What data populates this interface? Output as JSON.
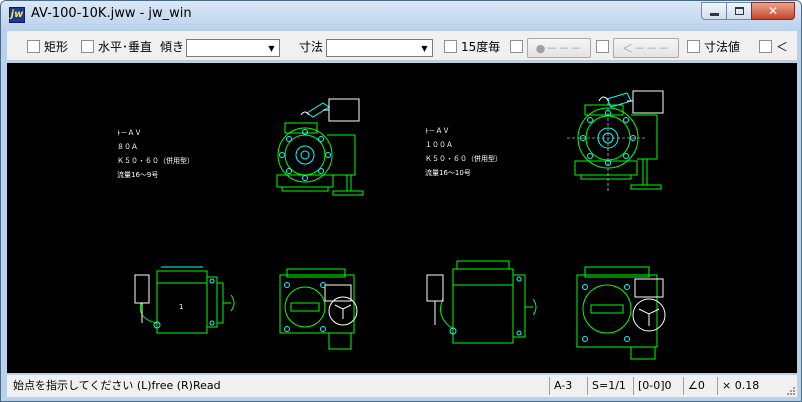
{
  "window": {
    "title": "AV-100-10K.jww - jw_win"
  },
  "toolbar": {
    "rect_label": "矩形",
    "hv_label": "水平･垂直",
    "slope_label": "傾き",
    "dim_label": "寸法",
    "deg15_label": "15度毎",
    "point_btn": "●－－－",
    "arrow_btn": "＜－－－",
    "dimval_label": "寸法値",
    "more_label": "＜"
  },
  "drawing": {
    "block1": {
      "line1": "ﾄ－ＡＶ",
      "line2": "８０Ａ",
      "line3": "Ｋ５０・６０（併用型）",
      "line4": "流量16～9号"
    },
    "block2": {
      "line1": "ﾄ－ＡＶ",
      "line2": "１００Ａ",
      "line3": "Ｋ５０・６０（併用型）",
      "line4": "流量16～10号"
    }
  },
  "status": {
    "message": "始点を指示してください (L)free (R)Read",
    "paper": "A-3",
    "scale": "S=1/1",
    "layer": "[0-0]0",
    "angle": "∠0",
    "factor": "× 0.18"
  },
  "colors": {
    "green": "#00ff00",
    "cyan": "#00ffff",
    "white": "#ffffff",
    "canvas": "#000000"
  }
}
